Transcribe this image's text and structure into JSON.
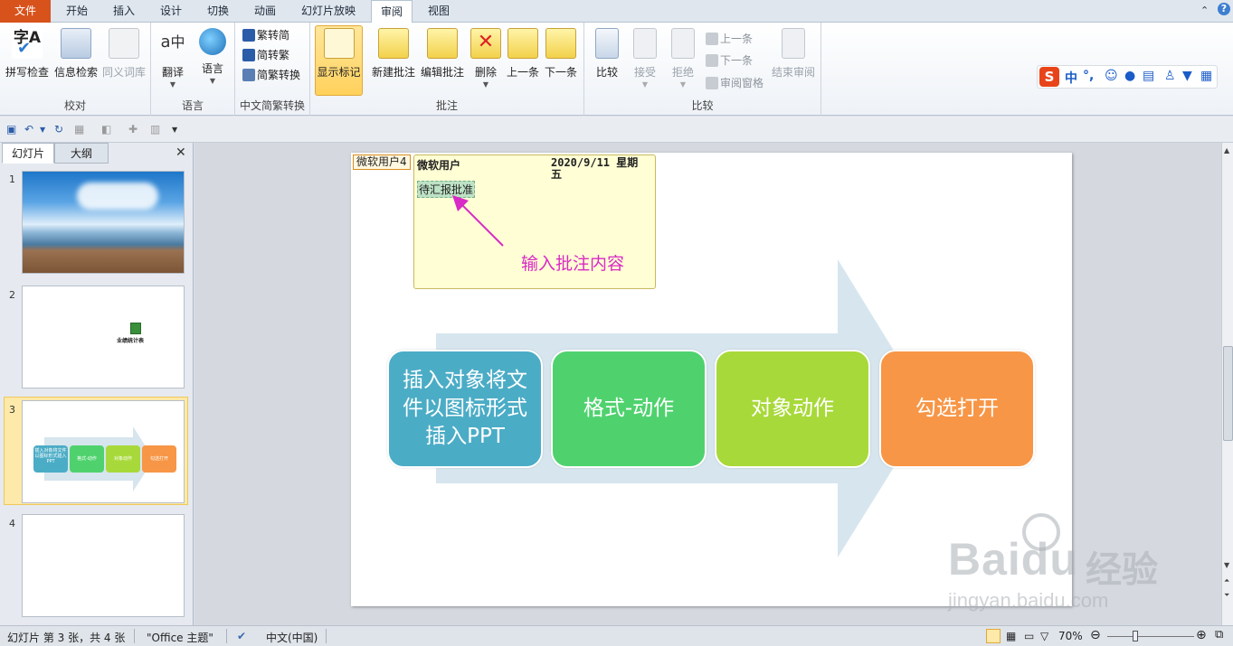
{
  "tabs": [
    "文件",
    "开始",
    "插入",
    "设计",
    "切换",
    "动画",
    "幻灯片放映",
    "审阅",
    "视图"
  ],
  "ribbon": {
    "proofing": {
      "label": "校对",
      "spell": "拼写检查",
      "research": "信息检索",
      "thesaurus": "同义词库"
    },
    "language": {
      "label": "语言",
      "translate": "翻译",
      "language": "语言"
    },
    "chinese": {
      "label": "中文简繁转换",
      "t2s": "繁转简",
      "s2t": "简转繁",
      "convert": "简繁转换"
    },
    "comments": {
      "label": "批注",
      "show": "显示标记",
      "new": "新建批注",
      "edit": "编辑批注",
      "delete": "删除",
      "prev": "上一条",
      "next": "下一条"
    },
    "compare": {
      "label": "比较",
      "compare": "比较",
      "accept": "接受",
      "reject": "拒绝",
      "prev": "上一条",
      "next": "下一条",
      "pane": "审阅窗格",
      "end": "结束审阅"
    }
  },
  "ime": {
    "logo": "S",
    "lang": "中",
    "punct": "°,"
  },
  "panel": {
    "tab_slides": "幻灯片",
    "tab_outline": "大纲",
    "close": "✕"
  },
  "thumbs": [
    {
      "num": "1"
    },
    {
      "num": "2",
      "caption": "业绩统计表"
    },
    {
      "num": "3",
      "items": [
        "插入对象将文件以图标形式插入PPT",
        "格式-动作",
        "对象动作",
        "勾选打开"
      ]
    },
    {
      "num": "4"
    }
  ],
  "comment": {
    "marker": "微软用户4",
    "author": "微软用户",
    "date": "2020/9/11 星期五",
    "text": "待汇报批准",
    "note": "输入批注内容"
  },
  "smartart": [
    {
      "text": "插入对象将文件以图标形式插入PPT",
      "color": "#4bacc6"
    },
    {
      "text": "格式-动作",
      "color": "#4fd26e"
    },
    {
      "text": "对象动作",
      "color": "#a8d93a"
    },
    {
      "text": "勾选打开",
      "color": "#f79646"
    }
  ],
  "status": {
    "slide": "幻灯片 第 3 张，共 4 张",
    "theme": "\"Office 主题\"",
    "lang": "中文(中国)",
    "zoom": "70%"
  },
  "watermark": {
    "brand": "Baidu",
    "cn": "经验",
    "url": "jingyan.baidu.com"
  }
}
